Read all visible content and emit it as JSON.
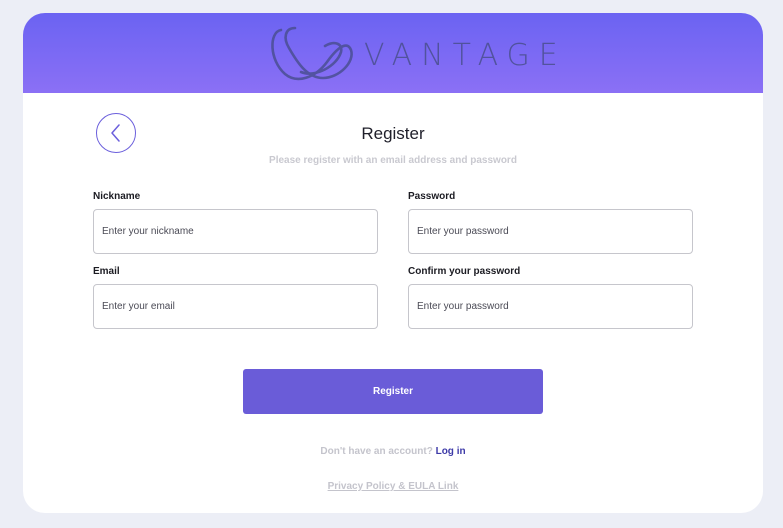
{
  "brand": {
    "name": "VANTAGE",
    "logo_icon": "infinity-loop-logo",
    "header_gradient": [
      "#6b63f2",
      "#8b70f5"
    ]
  },
  "form": {
    "back_icon": "chevron-left-icon",
    "title": "Register",
    "subtitle": "Please register with an email address and password",
    "nickname": {
      "label": "Nickname",
      "placeholder": "Enter your nickname",
      "value": ""
    },
    "password": {
      "label": "Password",
      "placeholder": "Enter your password",
      "value": ""
    },
    "email": {
      "label": "Email",
      "placeholder": "Enter your email",
      "value": ""
    },
    "confirm_password": {
      "label": "Confirm your password",
      "placeholder": "Enter your password",
      "value": ""
    },
    "submit_label": "Register",
    "accent_color": "#6a5cd8"
  },
  "footer": {
    "prompt": "Don't have an account?",
    "login_link": "Log in",
    "privacy_link": "Privacy Policy & EULA Link"
  }
}
